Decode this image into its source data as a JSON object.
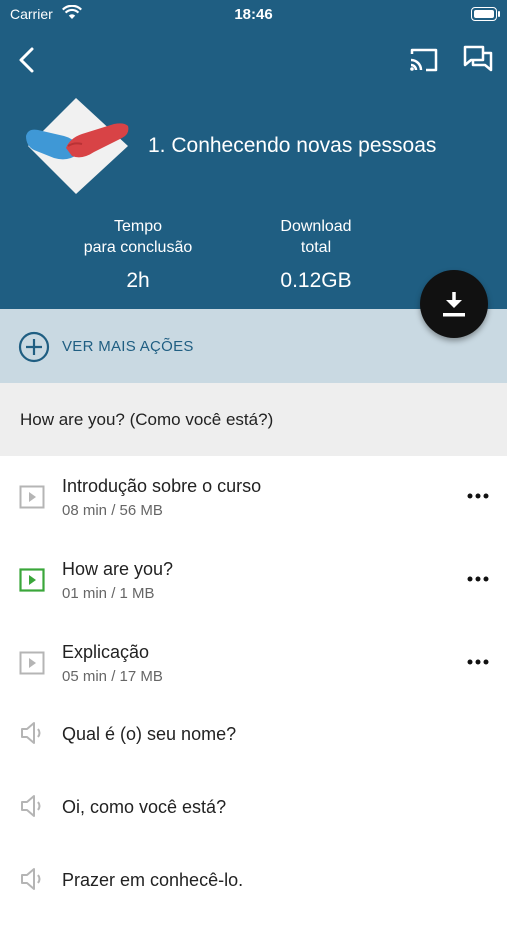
{
  "status_bar": {
    "carrier": "Carrier",
    "time": "18:46"
  },
  "header": {
    "course_title": "1. Conhecendo novas pessoas",
    "stats": {
      "time_label_line1": "Tempo",
      "time_label_line2": "para conclusão",
      "time_value": "2h",
      "download_label_line1": "Download",
      "download_label_line2": "total",
      "download_value": "0.12GB"
    }
  },
  "actions": {
    "label": "VER MAIS AÇÕES"
  },
  "section": {
    "title": "How are you? (Como você está?)"
  },
  "lessons": [
    {
      "title": "Introdução sobre o curso",
      "meta": "08 min / 56 MB",
      "icon": "video-icon",
      "active": false
    },
    {
      "title": "How are you?",
      "meta": "01 min / 1 MB",
      "icon": "video-icon",
      "active": true
    },
    {
      "title": "Explicação",
      "meta": "05 min / 17 MB",
      "icon": "video-icon",
      "active": false
    }
  ],
  "audio_items": [
    {
      "title": "Qual é (o) seu nome?",
      "icon": "speaker-icon"
    },
    {
      "title": "Oi, como você está?",
      "icon": "speaker-icon"
    },
    {
      "title": "Prazer em conhecê-lo.",
      "icon": "speaker-icon"
    }
  ],
  "colors": {
    "header_bg": "#1f5e82",
    "actions_bg": "#c9d9e2",
    "section_bg": "#eeeeee",
    "active_icon": "#3aa63a",
    "inactive_icon": "#b5b5b5",
    "fab_bg": "#111111"
  }
}
